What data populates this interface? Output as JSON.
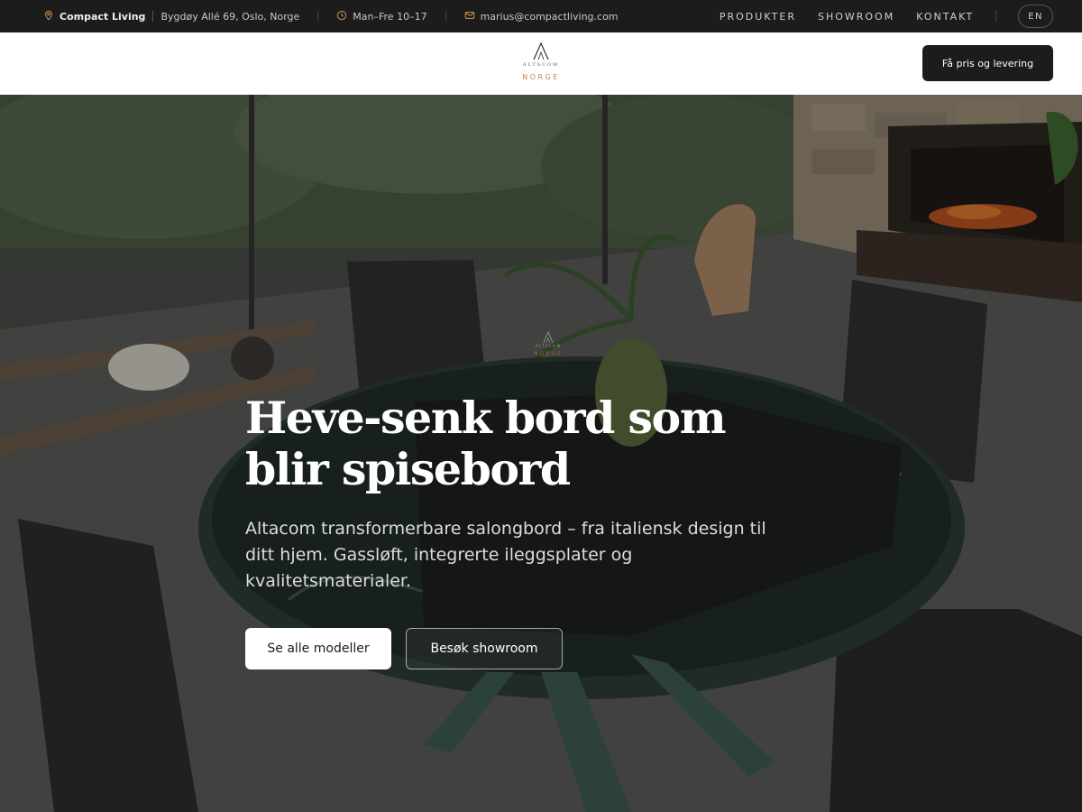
{
  "topbar": {
    "company": "Compact Living",
    "address": "Bygdøy Allé 69, Oslo, Norge",
    "hours": "Man–Fre 10–17",
    "email": "marius@compactliving.com",
    "nav": [
      "PRODUKTER",
      "SHOWROOM",
      "KONTAKT"
    ],
    "language": "EN",
    "icon_names": [
      "location-pin-icon",
      "clock-icon",
      "mail-icon"
    ]
  },
  "header": {
    "logo_brand": "ALTACOM",
    "logo_country": "NORGE",
    "cta_label": "Få pris og levering"
  },
  "hero": {
    "watermark_brand": "ALTACOM",
    "watermark_country": "NORGE",
    "title": "Heve-senk bord som blir spisebord",
    "lead": "Altacom transformerbare salongbord – fra italiensk design til ditt hjem. Gassløft, integrerte ileggsplater og kvalitetsmaterialer.",
    "primary_button": "Se alle modeller",
    "secondary_button": "Besøk showroom"
  },
  "colors": {
    "accent": "#c08a4b",
    "dark": "#1c1c1c",
    "white": "#ffffff"
  }
}
